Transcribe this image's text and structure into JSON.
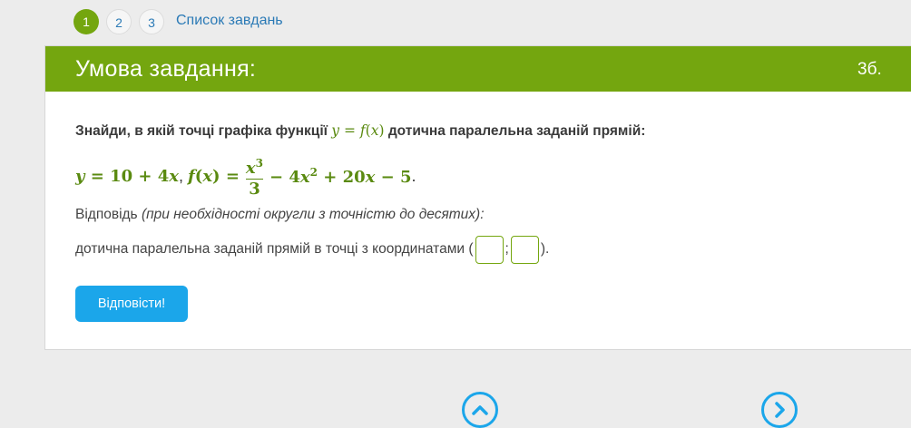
{
  "steps": [
    "1",
    "2",
    "3"
  ],
  "tasks_link": "Список завдань",
  "header": {
    "title": "Умова завдання:",
    "points": "3б."
  },
  "question": {
    "text_before": "Знайди, в якій точці графіка функції ",
    "text_after": " дотична паралельна заданій прямій:"
  },
  "answer": {
    "label": "Відповідь ",
    "hint": "(при необхідності округли з точністю до десятих):",
    "prefix": "дотична паралельна заданій прямій в точці з координатами (",
    "separator": ";",
    "suffix": ").",
    "x_value": "",
    "y_value": ""
  },
  "submit_label": "Відповісти!",
  "icons": {
    "up": "chevron-up-icon",
    "next": "chevron-right-icon"
  },
  "colors": {
    "accent": "#74a60f",
    "button": "#1ba6ea",
    "link": "#2b7ab6"
  }
}
